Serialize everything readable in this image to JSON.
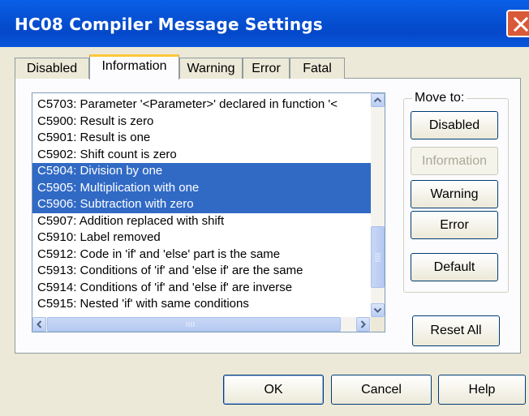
{
  "window": {
    "title": "HC08 Compiler Message Settings"
  },
  "tabs": [
    {
      "label": "Disabled",
      "active": false
    },
    {
      "label": "Information",
      "active": true
    },
    {
      "label": "Warning",
      "active": false
    },
    {
      "label": "Error",
      "active": false
    },
    {
      "label": "Fatal",
      "active": false
    }
  ],
  "messages": [
    {
      "text": "C5703: Parameter '<Parameter>' declared in function '<",
      "selected": false
    },
    {
      "text": "C5900: Result is zero",
      "selected": false
    },
    {
      "text": "C5901: Result is one",
      "selected": false
    },
    {
      "text": "C5902: Shift count is zero",
      "selected": false
    },
    {
      "text": "C5904: Division by one",
      "selected": true
    },
    {
      "text": "C5905: Multiplication with one",
      "selected": true
    },
    {
      "text": "C5906: Subtraction with zero",
      "selected": true
    },
    {
      "text": "C5907: Addition replaced with shift",
      "selected": false
    },
    {
      "text": "C5910: Label removed",
      "selected": false
    },
    {
      "text": "C5912: Code in 'if' and 'else' part is the same",
      "selected": false
    },
    {
      "text": "C5913: Conditions of 'if' and 'else if' are the same",
      "selected": false
    },
    {
      "text": "C5914: Conditions of 'if' and 'else if' are inverse",
      "selected": false
    },
    {
      "text": "C5915: Nested 'if' with same conditions",
      "selected": false
    }
  ],
  "move_to": {
    "label": "Move to:",
    "disabled": "Disabled",
    "information": "Information",
    "warning": "Warning",
    "error": "Error",
    "default": "Default"
  },
  "reset_all": "Reset All",
  "footer": {
    "ok": "OK",
    "cancel": "Cancel",
    "help": "Help"
  },
  "colors": {
    "selection": "#316ac5",
    "titlebar": "#0754d8",
    "close": "#d95a38",
    "tab_highlight": "#ffc83c"
  }
}
